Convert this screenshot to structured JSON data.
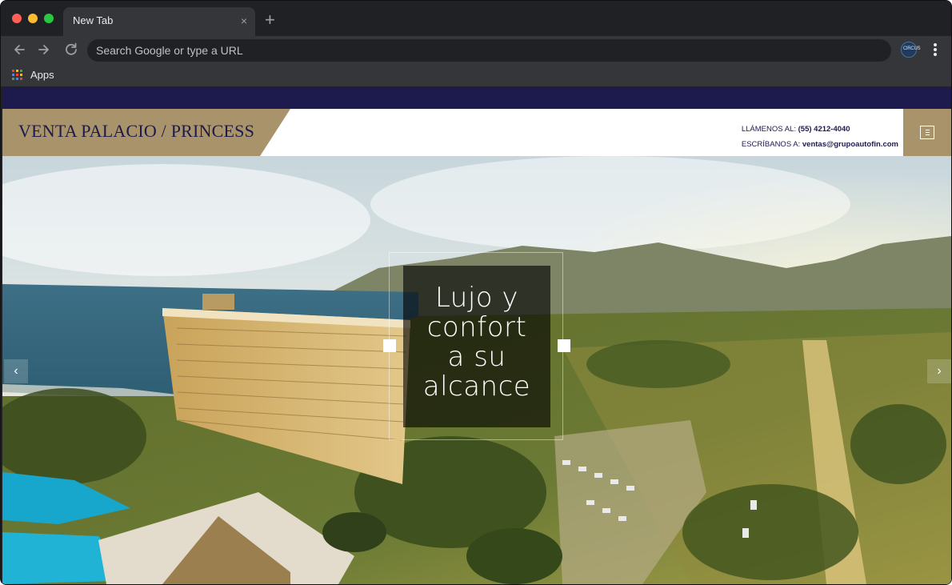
{
  "browser": {
    "tab_title": "New Tab",
    "tab_close": "×",
    "new_tab": "+",
    "address_placeholder": "Search Google or type a URL",
    "bookmarks": {
      "apps_label": "Apps"
    },
    "extension_label": "CIRCUS"
  },
  "site": {
    "brand_title": "VENTA PALACIO / PRINCESS",
    "contact": {
      "call_label": "LLÁMENOS AL:",
      "phone": "(55) 4212-4040",
      "write_label": "ESCRÍBANOS A:",
      "email": "ventas@grupoautofin.com"
    },
    "colors": {
      "topbar": "#1d1a4d",
      "gold": "#a8936a",
      "navy_text": "#1d1a4d"
    }
  },
  "hero": {
    "caption_lines": [
      "Lujo y",
      "confort",
      "a su",
      "alcance"
    ],
    "prev_arrow": "‹",
    "next_arrow": "›"
  }
}
